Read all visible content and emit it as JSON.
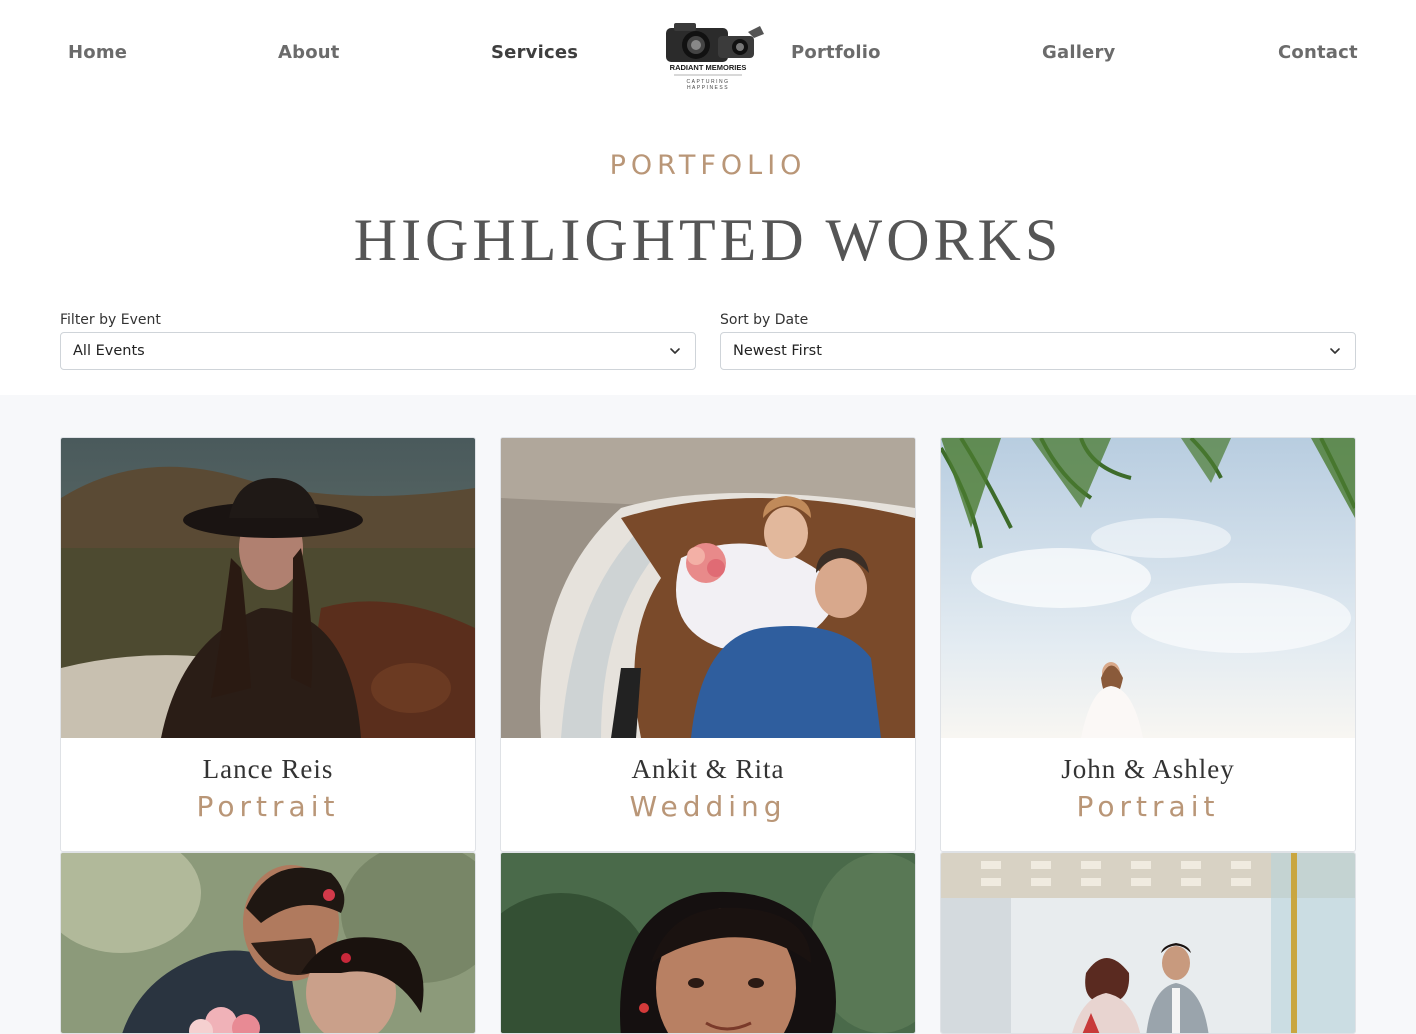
{
  "nav": {
    "links": [
      "Home",
      "About",
      "Services",
      "Portfolio",
      "Gallery",
      "Contact"
    ],
    "active": "Services",
    "logo_text": "RADIANT MEMORIES",
    "logo_tagline_1": "CAPTURING",
    "logo_tagline_2": "HAPPINESS"
  },
  "hero": {
    "eyebrow": "PORTFOLIO",
    "headline": "HIGHLIGHTED WORKS"
  },
  "filters": {
    "event_label": "Filter by Event",
    "event_value": "All Events",
    "date_label": "Sort by Date",
    "date_value": "Newest First"
  },
  "cards": [
    {
      "name": "Lance Reis",
      "category": "Portrait"
    },
    {
      "name": "Ankit & Rita",
      "category": "Wedding"
    },
    {
      "name": "John & Ashley",
      "category": "Portrait"
    }
  ],
  "colors": {
    "accent": "#b99677",
    "text_dark": "#3e3e3e",
    "nav_text": "#6b6b6b",
    "gallery_bg": "#f7f8fa"
  }
}
